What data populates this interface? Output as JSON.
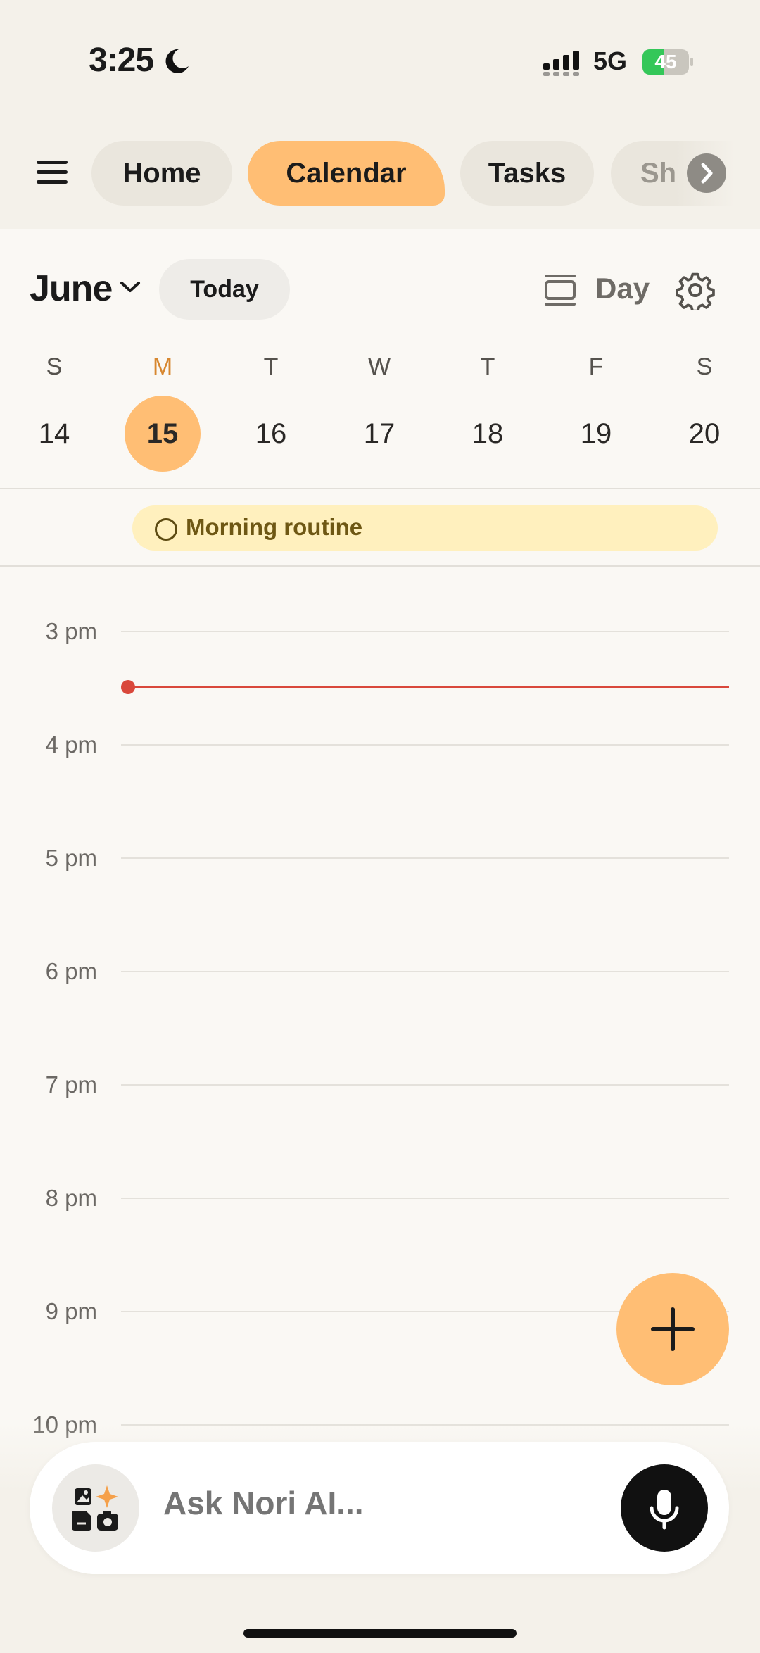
{
  "status_bar": {
    "time": "3:25",
    "network": "5G",
    "battery_level": "45",
    "battery_fraction": 0.45
  },
  "nav": {
    "tabs": [
      {
        "label": "Home",
        "active": false
      },
      {
        "label": "Calendar",
        "active": true
      },
      {
        "label": "Tasks",
        "active": false
      },
      {
        "label": "Sh",
        "active": false
      }
    ]
  },
  "calendar": {
    "month": "June",
    "today_button": "Today",
    "view_mode": "Day",
    "weekdays": [
      "S",
      "M",
      "T",
      "W",
      "T",
      "F",
      "S"
    ],
    "dates": [
      "14",
      "15",
      "16",
      "17",
      "18",
      "19",
      "20"
    ],
    "selected_date": "15",
    "all_day_event": {
      "title": "Morning routine"
    },
    "hours": [
      "3 pm",
      "4 pm",
      "5 pm",
      "6 pm",
      "7 pm",
      "8 pm",
      "9 pm",
      "10 pm"
    ]
  },
  "ask_bar": {
    "placeholder": "Ask Nori AI..."
  },
  "colors": {
    "accent": "#FFBE74",
    "now_line": "#D9483B",
    "event_bg": "#FFF0BE",
    "today_text": "#D7872F"
  }
}
